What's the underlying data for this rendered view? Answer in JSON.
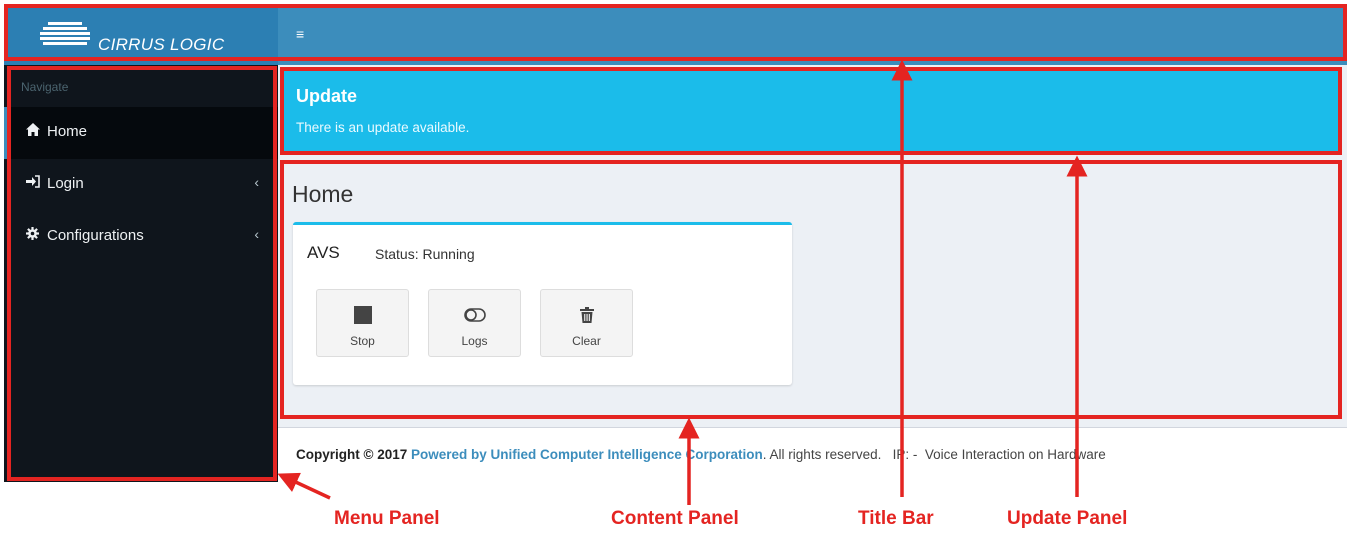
{
  "brand": {
    "logo_text": "CIRRUS LOGIC"
  },
  "topbar": {
    "menu_glyph": "≡"
  },
  "sidebar": {
    "header": "Navigate",
    "items": [
      {
        "label": "Home",
        "icon": "home-icon",
        "active": true
      },
      {
        "label": "Login",
        "icon": "sign-in-icon",
        "chevron": "‹"
      },
      {
        "label": "Configurations",
        "icon": "gear-icon",
        "chevron": "‹"
      }
    ]
  },
  "update": {
    "title": "Update",
    "text": "There is an update available."
  },
  "content": {
    "page_title": "Home",
    "box": {
      "title": "AVS",
      "status_label": "Status: Running",
      "buttons": [
        {
          "label": "Stop",
          "icon": "stop-icon"
        },
        {
          "label": "Logs",
          "icon": "toggle-icon"
        },
        {
          "label": "Clear",
          "icon": "trash-icon"
        }
      ]
    }
  },
  "footer": {
    "copyright": "Copyright © 2017",
    "link": "Powered by Unified Computer Intelligence Corporation",
    "rights": ". All rights reserved.",
    "ip": "IP: -",
    "tagline": "Voice Interaction on Hardware"
  },
  "annotations": {
    "menu_panel": "Menu Panel",
    "content_panel": "Content Panel",
    "title_bar": "Title Bar",
    "update_panel": "Update Panel",
    "color": "#e42421"
  },
  "colors": {
    "brand_blue": "#3c8dbc",
    "update_cyan": "#1bbcea",
    "sidebar_dark": "#0f151c"
  }
}
